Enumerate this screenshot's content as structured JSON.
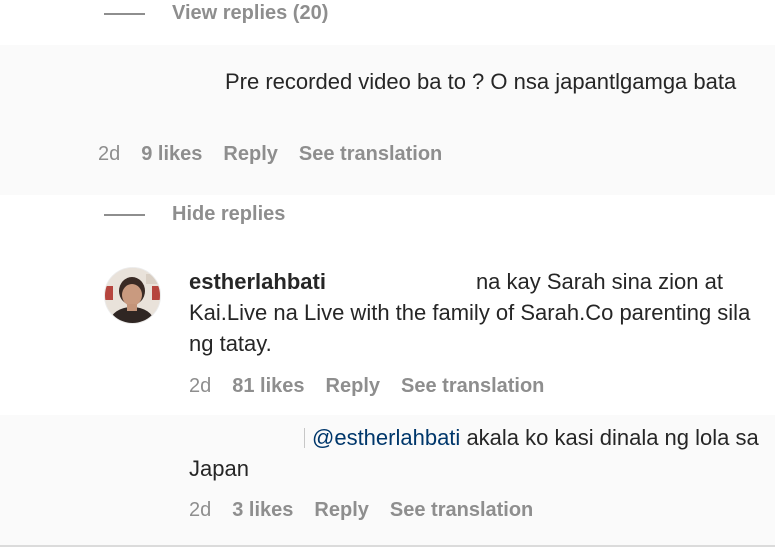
{
  "thread": {
    "view_replies_label": "View replies (20)",
    "hide_replies_label": "Hide replies"
  },
  "comments": [
    {
      "text": "Pre recorded video ba to ? O nsa japantlgamga bata",
      "time": "2d",
      "likes": "9 likes",
      "reply_label": "Reply",
      "translate_label": "See translation"
    },
    {
      "username": "estherlahbati",
      "text": "na kay Sarah sina zion at Kai.Live na Live with the family of Sarah.Co parenting sila ng tatay.",
      "time": "2d",
      "likes": "81 likes",
      "reply_label": "Reply",
      "translate_label": "See translation",
      "avatar_icon": "profile-photo"
    },
    {
      "mention": "@estherlahbati",
      "text": "akala ko kasi dinala ng lola sa Japan",
      "time": "2d",
      "likes": "3 likes",
      "reply_label": "Reply",
      "translate_label": "See translation"
    }
  ],
  "colors": {
    "text": "#262626",
    "secondary": "#8e8e8e",
    "mention": "#00376b",
    "gray_band": "#fafafa"
  }
}
